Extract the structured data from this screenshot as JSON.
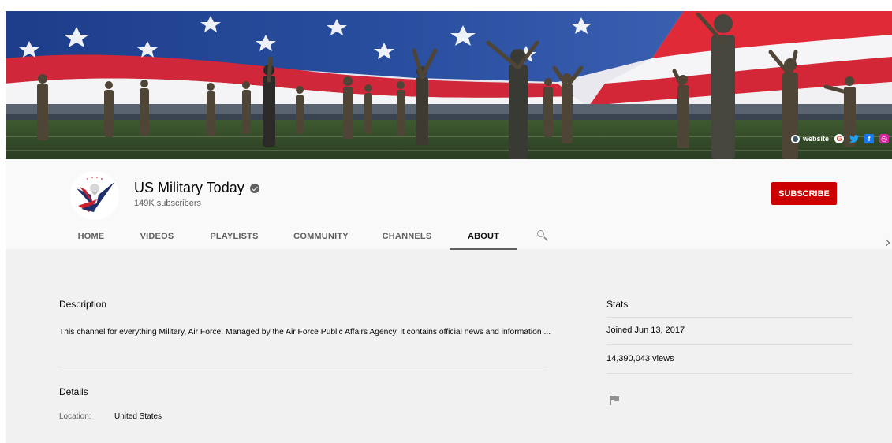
{
  "banner": {
    "social_links": [
      {
        "label": "website",
        "icon": "globe-icon"
      },
      {
        "label": "",
        "icon": "google-icon",
        "glyph": "G"
      },
      {
        "label": "",
        "icon": "twitter-icon",
        "glyph": "🐦"
      },
      {
        "label": "",
        "icon": "facebook-icon",
        "glyph": "f"
      },
      {
        "label": "",
        "icon": "instagram-icon",
        "glyph": "◎"
      }
    ]
  },
  "channel": {
    "name": "US Military Today",
    "subscribers": "149K subscribers",
    "subscribe_label": "SUBSCRIBE",
    "brand_color": "#cc0000"
  },
  "tabs": [
    {
      "label": "HOME",
      "active": false
    },
    {
      "label": "VIDEOS",
      "active": false
    },
    {
      "label": "PLAYLISTS",
      "active": false
    },
    {
      "label": "COMMUNITY",
      "active": false
    },
    {
      "label": "CHANNELS",
      "active": false
    },
    {
      "label": "ABOUT",
      "active": true
    }
  ],
  "about": {
    "description_heading": "Description",
    "description_text": "This channel for everything Military, Air Force. Managed by the Air Force Public Affairs Agency, it contains official news and information ...",
    "details_heading": "Details",
    "location_label": "Location:",
    "location_value": "United States",
    "stats_heading": "Stats",
    "joined": "Joined Jun 13, 2017",
    "views": "14,390,043 views"
  }
}
